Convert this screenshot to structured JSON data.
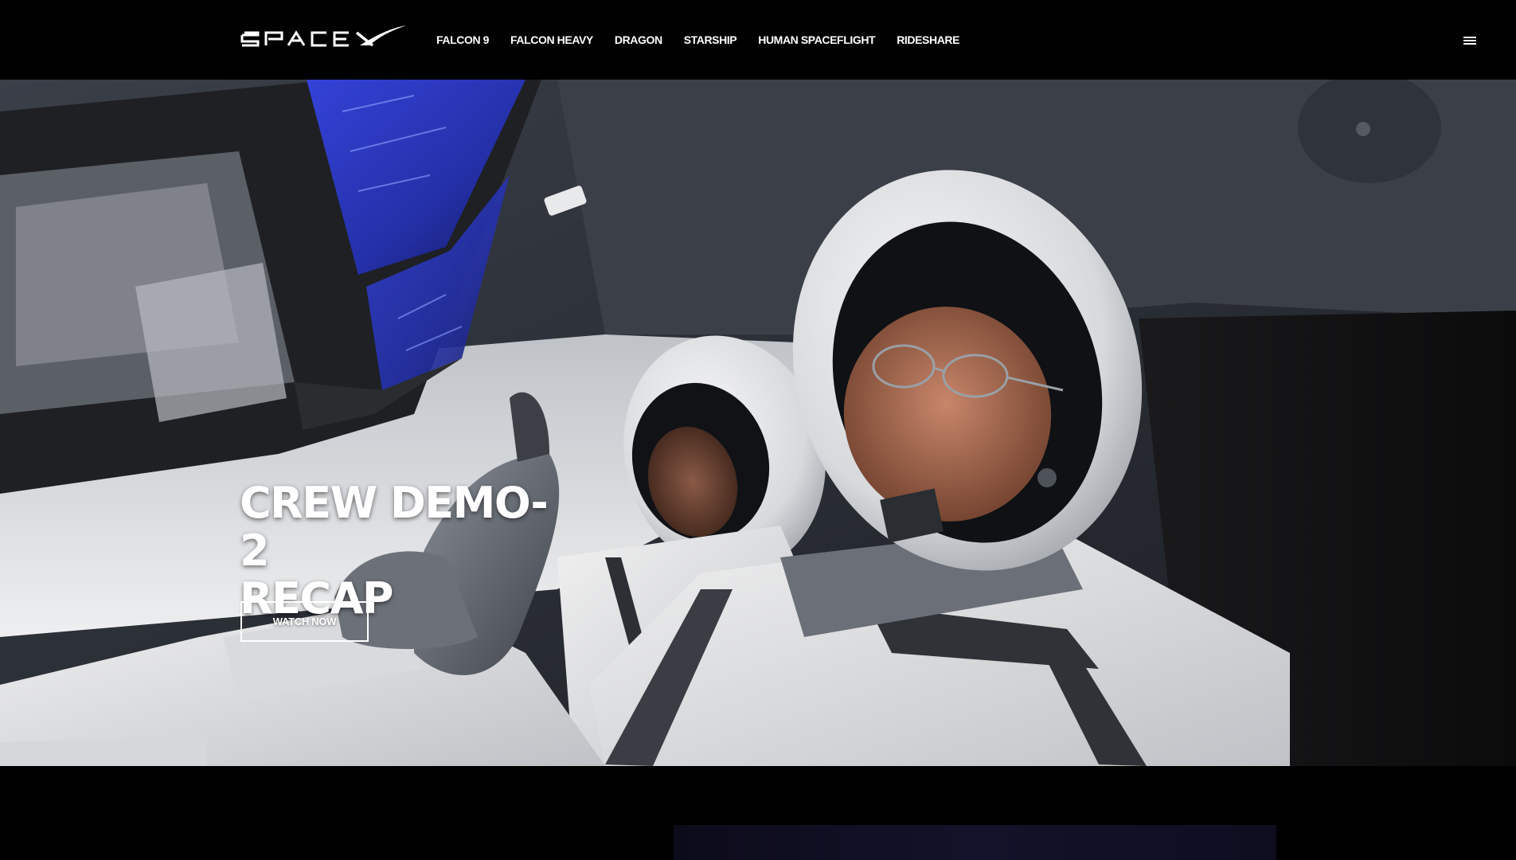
{
  "brand": {
    "logo_text": "SPACEX"
  },
  "nav": {
    "items": [
      {
        "label": "FALCON 9"
      },
      {
        "label": "FALCON HEAVY"
      },
      {
        "label": "DRAGON"
      },
      {
        "label": "STARSHIP"
      },
      {
        "label": "HUMAN SPACEFLIGHT"
      },
      {
        "label": "RIDESHARE"
      }
    ],
    "menu_icon": "hamburger-menu-icon"
  },
  "hero": {
    "title_line1": "CREW DEMO-2",
    "title_line2": "RECAP",
    "cta_label": "WATCH NOW",
    "image_description_icon": "astronauts-in-dragon-capsule-photo"
  },
  "colors": {
    "background": "#000000",
    "text": "#ffffff"
  }
}
